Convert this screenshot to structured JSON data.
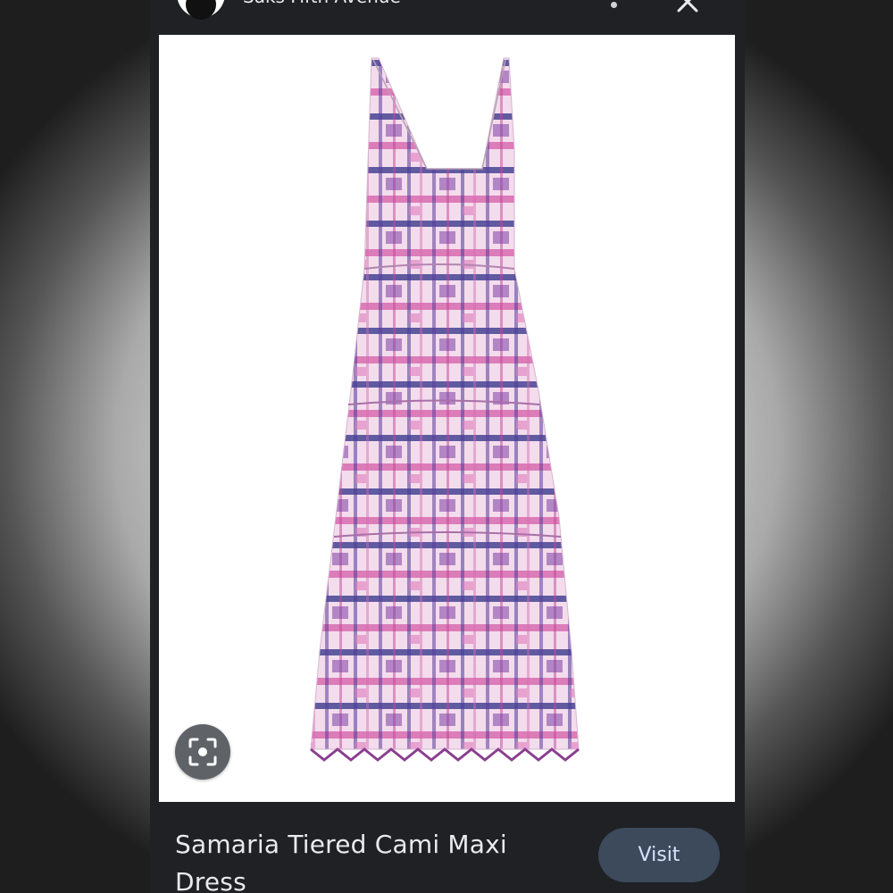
{
  "source": {
    "name": "Saks Fifth Avenue",
    "logo": "saks-logo"
  },
  "header": {
    "more_icon": "more-vert-icon",
    "close_icon": "close-icon"
  },
  "image": {
    "subject": "tie-dye tiered cami maxi dress"
  },
  "lens": {
    "icon": "lens-icon"
  },
  "product": {
    "title": "Samaria Tiered Cami Maxi Dress"
  },
  "actions": {
    "visit_label": "Visit"
  },
  "colors": {
    "background": "#1f2124",
    "visit_bg": "#3c4a5c",
    "visit_text": "#d6e3ff",
    "print_magenta": "#d04a9e",
    "print_navy": "#3b3a8f"
  }
}
